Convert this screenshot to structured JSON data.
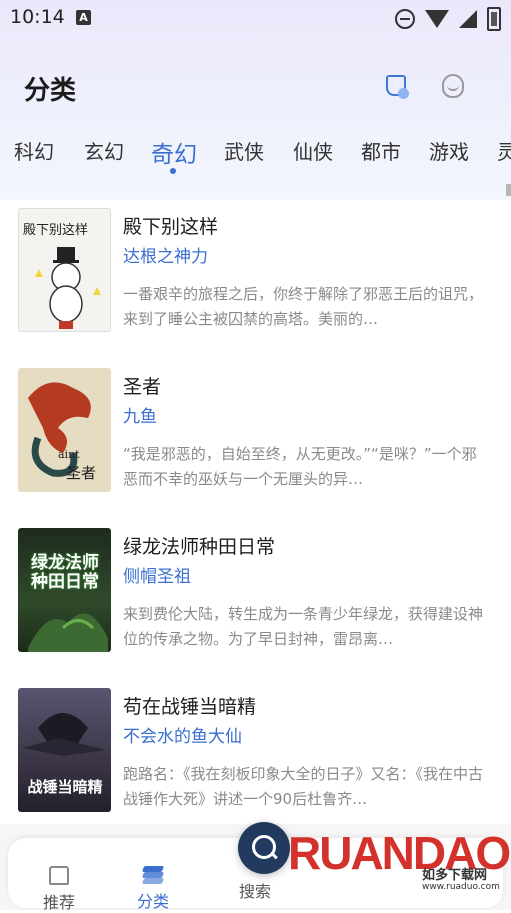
{
  "status_bar": {
    "time": "10:14",
    "notif_glyph": "A"
  },
  "header": {
    "title": "分类",
    "icons": [
      "cup-icon",
      "face-icon"
    ]
  },
  "tabs": [
    {
      "label": "科幻",
      "active": false
    },
    {
      "label": "玄幻",
      "active": false
    },
    {
      "label": "奇幻",
      "active": true
    },
    {
      "label": "武侠",
      "active": false
    },
    {
      "label": "仙侠",
      "active": false
    },
    {
      "label": "都市",
      "active": false
    },
    {
      "label": "游戏",
      "active": false
    },
    {
      "label": "灵",
      "active": false
    }
  ],
  "books": [
    {
      "title": "殿下别这样",
      "author": "达根之神力",
      "desc": "一番艰辛的旅程之后，你终于解除了邪恶王后的诅咒，来到了睡公主被囚禁的高塔。美丽的…",
      "cover_text": "殿下别这样"
    },
    {
      "title": "圣者",
      "author": "九鱼",
      "desc": "“我是邪恶的，自始至终，从无更改。”“是咪？”一个邪恶而不幸的巫妖与一个无厘头的异…",
      "cover_text": "圣者"
    },
    {
      "title": "绿龙法师种田日常",
      "author": "侧帽圣祖",
      "desc": "来到费伦大陆，转生成为一条青少年绿龙，获得建设神位的传承之物。为了早日封神，雷昂离…",
      "cover_text": "绿龙法师种田日常"
    },
    {
      "title": "苟在战锤当暗精",
      "author": "不会水的鱼大仙",
      "desc": "跑路名：《我在刻板印象大全的日子》又名：《我在中古战锤作大死》讲述一个90后杜鲁齐…",
      "cover_text": "战锤当暗精"
    }
  ],
  "bottom_nav": {
    "items": [
      {
        "label": "推荐",
        "icon": "home-icon",
        "active": false
      },
      {
        "label": "分类",
        "icon": "layers-icon",
        "active": true
      },
      {
        "label": "搜索",
        "icon": "search-icon",
        "active": false
      }
    ]
  },
  "watermark": {
    "logo": "RUANDAO",
    "name": "如多下载网",
    "url": "www.ruaduo.com"
  },
  "colors": {
    "accent": "#3a6fd0",
    "header_bg": "#ebe7fb",
    "watermark": "#d3322c"
  }
}
